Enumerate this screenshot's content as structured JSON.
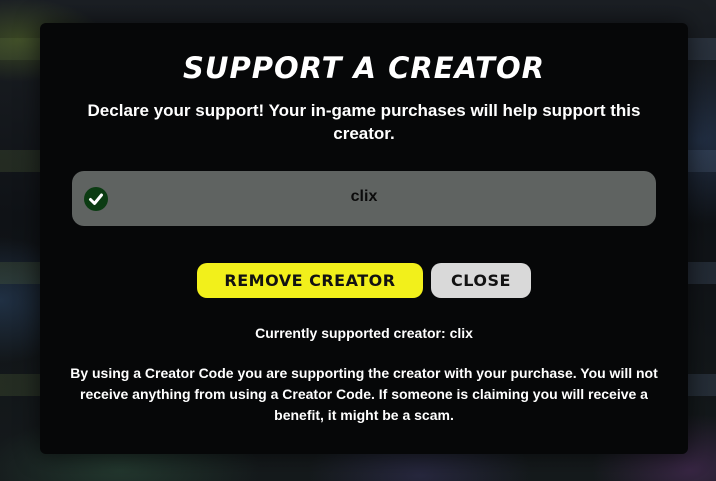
{
  "modal": {
    "title": "SUPPORT A CREATOR",
    "subtitle": "Declare your support! Your in-game purchases will help support this creator.",
    "code_field": {
      "value": "clix",
      "status_icon": "check-circle-icon"
    },
    "buttons": {
      "remove_label": "REMOVE CREATOR",
      "close_label": "CLOSE"
    },
    "current_label": "Currently supported creator:",
    "current_creator": "clix",
    "disclaimer": "By using a Creator Code you are supporting the creator with your purchase. You will not receive anything from using a Creator Code. If someone is claiming you will receive a benefit, it might be a scam."
  },
  "colors": {
    "modal_bg": "#060708",
    "field_bg": "#5f6361",
    "check_bg": "#0b3b12",
    "remove_button": "#f2f01b",
    "close_button": "#d9d9d9"
  }
}
